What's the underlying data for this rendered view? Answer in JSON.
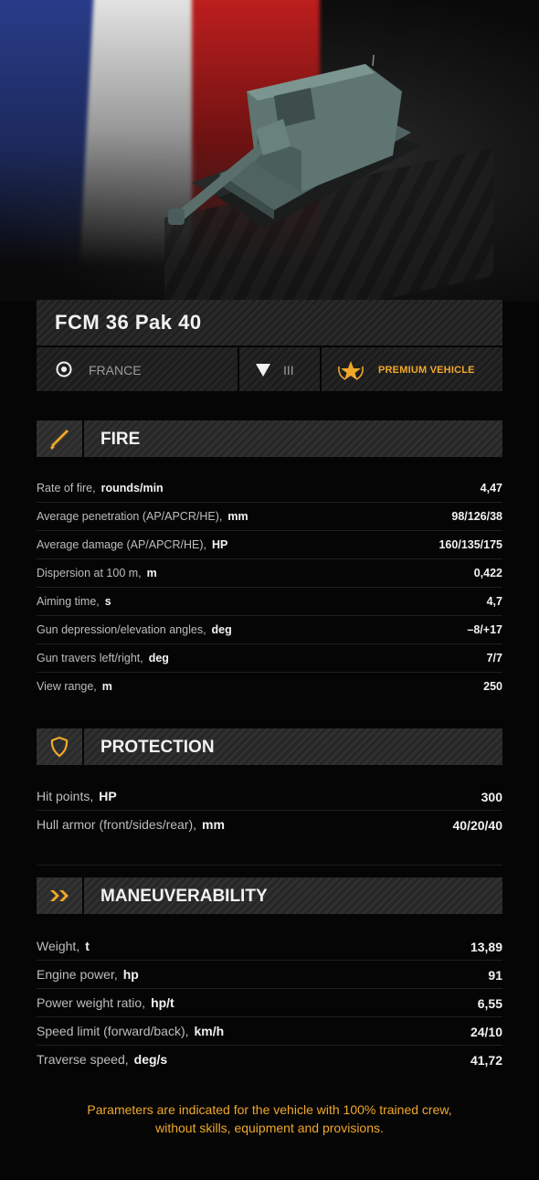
{
  "vehicle": {
    "name": "FCM 36 Pak 40"
  },
  "info": {
    "nation": "FRANCE",
    "tier": "III",
    "premium_label": "PREMIUM VEHICLE"
  },
  "colors": {
    "accent": "#f0a82a",
    "text": "#f2f2f2",
    "muted": "#bdbdbd",
    "background": "#050505"
  },
  "sections": {
    "fire": {
      "title": "FIRE",
      "icon": "shell-icon",
      "rows": [
        {
          "label": "Rate of fire,",
          "unit": "rounds/min",
          "value": "4,47"
        },
        {
          "label": "Average penetration (AP/APCR/HE),",
          "unit": "mm",
          "value": "98/126/38"
        },
        {
          "label": "Average damage (AP/APCR/HE),",
          "unit": "HP",
          "value": "160/135/175"
        },
        {
          "label": "Dispersion at 100 m,",
          "unit": "m",
          "value": "0,422"
        },
        {
          "label": "Aiming time,",
          "unit": "s",
          "value": "4,7"
        },
        {
          "label": "Gun depression/elevation angles,",
          "unit": "deg",
          "value": "–8/+17"
        },
        {
          "label": "Gun travers left/right,",
          "unit": "deg",
          "value": "7/7"
        },
        {
          "label": "View range,",
          "unit": "m",
          "value": "250"
        }
      ]
    },
    "protection": {
      "title": "PROTECTION",
      "icon": "shield-icon",
      "rows": [
        {
          "label": "Hit points,",
          "unit": "HP",
          "value": "300"
        },
        {
          "label": "Hull armor (front/sides/rear),",
          "unit": "mm",
          "value": "40/20/40"
        }
      ]
    },
    "maneuverability": {
      "title": "MANEUVERABILITY",
      "icon": "double-chevron-icon",
      "rows": [
        {
          "label": "Weight,",
          "unit": "t",
          "value": "13,89"
        },
        {
          "label": "Engine power,",
          "unit": "hp",
          "value": "91"
        },
        {
          "label": "Power weight ratio,",
          "unit": "hp/t",
          "value": "6,55"
        },
        {
          "label": "Speed limit (forward/back),",
          "unit": "km/h",
          "value": "24/10"
        },
        {
          "label": "Traverse speed,",
          "unit": "deg/s",
          "value": "41,72"
        }
      ]
    }
  },
  "footnote": {
    "line1": "Parameters are indicated for the vehicle with 100% trained crew,",
    "line2": "without skills, equipment and provisions."
  }
}
